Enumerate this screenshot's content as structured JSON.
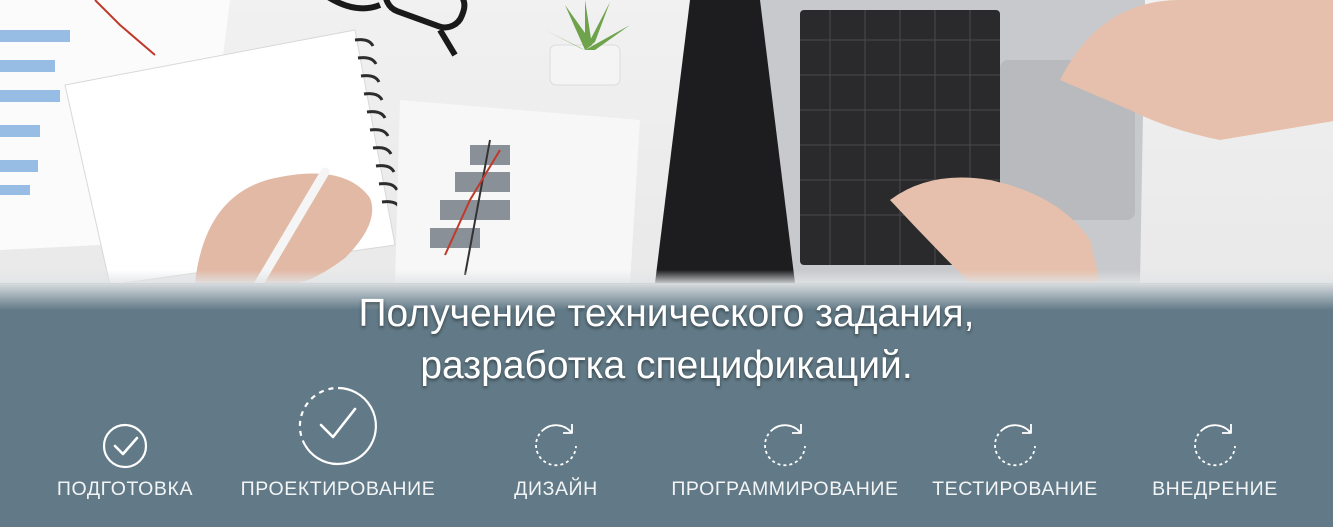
{
  "banner": {
    "photo_description_icon": "desk-photo"
  },
  "heading": {
    "line1": "Получение технического задания,",
    "line2": "разработка спецификаций."
  },
  "steps": [
    {
      "label": "ПОДГОТОВКА",
      "status": "done",
      "icon": "check-circle-icon"
    },
    {
      "label": "ПРОЕКТИРОВАНИЕ",
      "status": "current",
      "icon": "check-dashed-circle-icon"
    },
    {
      "label": "ДИЗАЙН",
      "status": "pending",
      "icon": "refresh-icon"
    },
    {
      "label": "ПРОГРАММИРОВАНИЕ",
      "status": "pending",
      "icon": "refresh-icon"
    },
    {
      "label": "ТЕСТИРОВАНИЕ",
      "status": "pending",
      "icon": "refresh-icon"
    },
    {
      "label": "ВНЕДРЕНИЕ",
      "status": "pending",
      "icon": "refresh-icon"
    }
  ],
  "colors": {
    "panel": "#627a87",
    "text": "#ffffff"
  }
}
